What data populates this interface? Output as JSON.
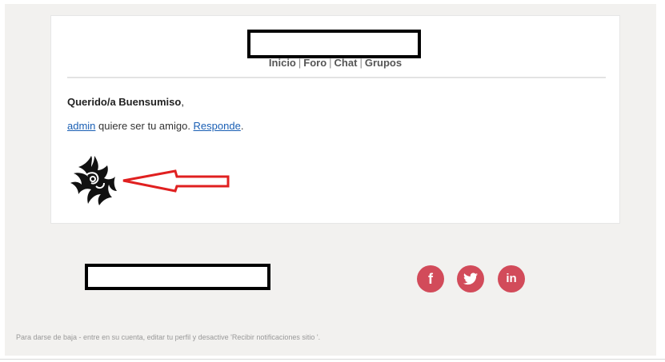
{
  "nav": {
    "items": [
      "Inicio",
      "Foro",
      "Chat",
      "Grupos"
    ],
    "separator": "|"
  },
  "email": {
    "greeting_prefix": "Querido/a Buensumiso",
    "greeting_suffix": ",",
    "sender_link": "admin",
    "message_text": " quiere ser tu amigo. ",
    "respond_link": "Responde",
    "message_end": "."
  },
  "social": {
    "facebook": "f",
    "twitter": "twitter-bird",
    "linkedin": "in"
  },
  "footer": {
    "unsubscribe_note": "Para darse de baja - entre en su cuenta, editar tu perfil y desactive 'Recibir notificaciones sitio '."
  },
  "colors": {
    "social_bg": "#d24b5a",
    "annotation_arrow": "#e02020",
    "link": "#1a5fb4"
  }
}
